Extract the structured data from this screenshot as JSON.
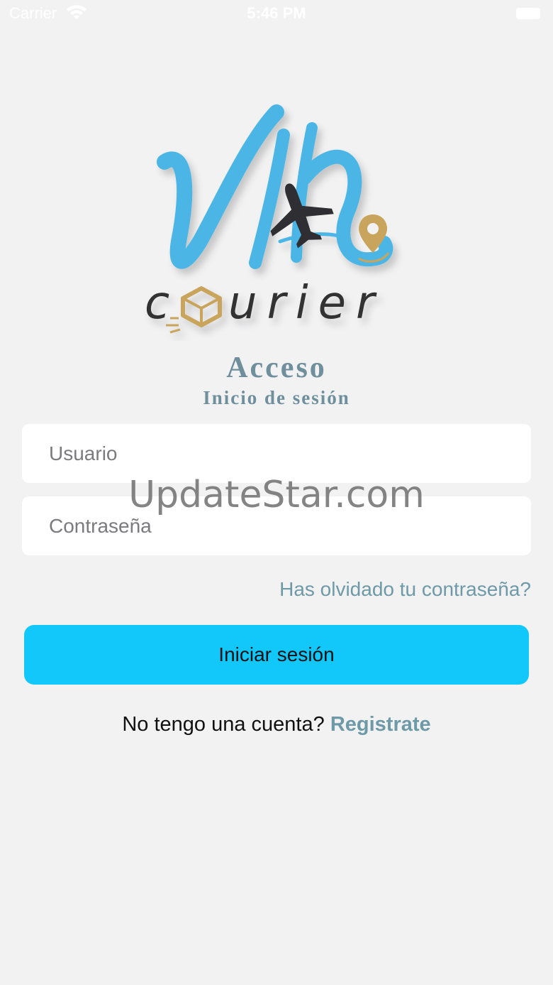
{
  "status_bar": {
    "carrier": "Carrier",
    "time": "5:46 PM"
  },
  "header": {
    "title": "Acceso",
    "subtitle": "Inicio de sesión"
  },
  "logo": {
    "script_text": "via",
    "word_text": "courier"
  },
  "form": {
    "username_placeholder": "Usuario",
    "username_value": "",
    "password_placeholder": "Contraseña",
    "password_value": "",
    "forgot_label": "Has olvidado tu contraseña?",
    "submit_label": "Iniciar sesión"
  },
  "register": {
    "prompt": "No tengo una cuenta?",
    "link_label": "Registrate"
  },
  "watermark": {
    "text": "UpdateStar.com"
  },
  "colors": {
    "background": "#f2f2f3",
    "accent_button": "#12c8fb",
    "link": "#6e9aa8",
    "logo_blue": "#4cb6e6",
    "logo_gold": "#c9a45c",
    "logo_dark": "#333333"
  },
  "icons": {
    "wifi": "wifi-icon",
    "battery": "battery-icon",
    "plane": "airplane-icon",
    "pin": "location-pin-icon",
    "box": "package-box-icon"
  }
}
